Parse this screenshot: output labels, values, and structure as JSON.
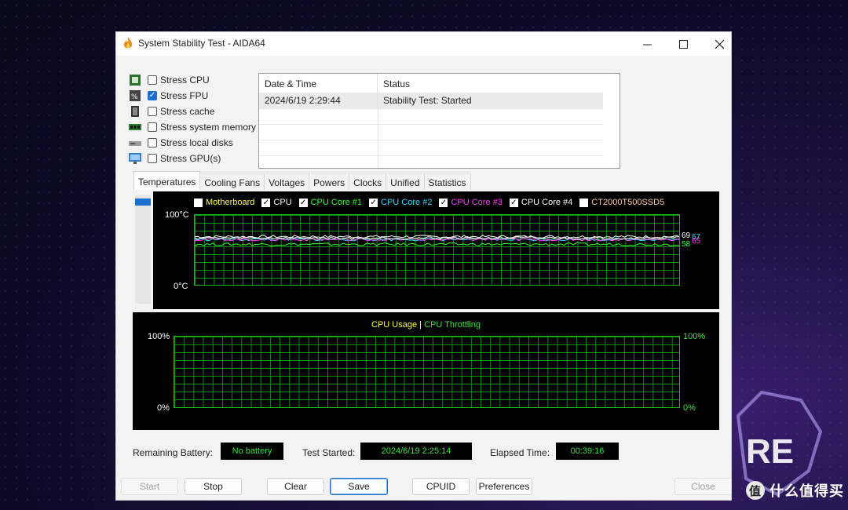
{
  "window": {
    "title": "System Stability Test - AIDA64"
  },
  "stress_options": [
    {
      "label": "Stress CPU",
      "checked": false,
      "icon": "cpu-chip-icon"
    },
    {
      "label": "Stress FPU",
      "checked": true,
      "icon": "fpu-chip-icon"
    },
    {
      "label": "Stress cache",
      "checked": false,
      "icon": "cache-chip-icon"
    },
    {
      "label": "Stress system memory",
      "checked": false,
      "icon": "memory-module-icon"
    },
    {
      "label": "Stress local disks",
      "checked": false,
      "icon": "disk-drive-icon"
    },
    {
      "label": "Stress GPU(s)",
      "checked": false,
      "icon": "monitor-icon"
    }
  ],
  "log": {
    "columns": [
      "Date & Time",
      "Status"
    ],
    "rows": [
      {
        "datetime": "2024/6/19 2:29:44",
        "status": "Stability Test: Started"
      }
    ]
  },
  "tabs": [
    "Temperatures",
    "Cooling Fans",
    "Voltages",
    "Powers",
    "Clocks",
    "Unified",
    "Statistics"
  ],
  "active_tab": "Temperatures",
  "temp_chart": {
    "legend": [
      {
        "label": "Motherboard",
        "checked": false,
        "color": "#ffff3a"
      },
      {
        "label": "CPU",
        "checked": true,
        "color": "#ffffff"
      },
      {
        "label": "CPU Core #1",
        "checked": true,
        "color": "#3aff3a"
      },
      {
        "label": "CPU Core #2",
        "checked": true,
        "color": "#3ad4ff"
      },
      {
        "label": "CPU Core #3",
        "checked": true,
        "color": "#ff3aff"
      },
      {
        "label": "CPU Core #4",
        "checked": true,
        "color": "#ffffff"
      },
      {
        "label": "CT2000T500SSD5",
        "checked": false,
        "color": "#ffc8a0"
      }
    ],
    "y_max_label": "100°C",
    "y_min_label": "0°C",
    "end_labels": [
      "69",
      "67",
      "65",
      "58"
    ]
  },
  "usage_chart": {
    "title_left": "CPU Usage",
    "title_sep": "|",
    "title_right": "CPU Throttling",
    "left_max": "100%",
    "left_min": "0%",
    "right_max": "100%",
    "right_min": "0%"
  },
  "status": {
    "battery_label": "Remaining Battery:",
    "battery_value": "No battery",
    "started_label": "Test Started:",
    "started_value": "2024/6/19 2:25:14",
    "elapsed_label": "Elapsed Time:",
    "elapsed_value": "00:39:16"
  },
  "buttons": {
    "start": "Start",
    "stop": "Stop",
    "clear": "Clear",
    "save": "Save",
    "cpuid": "CPUID",
    "preferences": "Preferences",
    "close": "Close"
  },
  "chart_data": {
    "type": "line",
    "y_range": [
      0,
      100
    ],
    "series": [
      {
        "name": "CPU",
        "end_value": 69
      },
      {
        "name": "CPU Core #1",
        "end_value": 58
      },
      {
        "name": "CPU Core #2",
        "end_value": 65
      },
      {
        "name": "CPU Core #3",
        "end_value": 65
      },
      {
        "name": "CPU Core #4",
        "end_value": 67
      }
    ]
  },
  "watermark": {
    "badge": "值",
    "text": "什么值得买"
  }
}
